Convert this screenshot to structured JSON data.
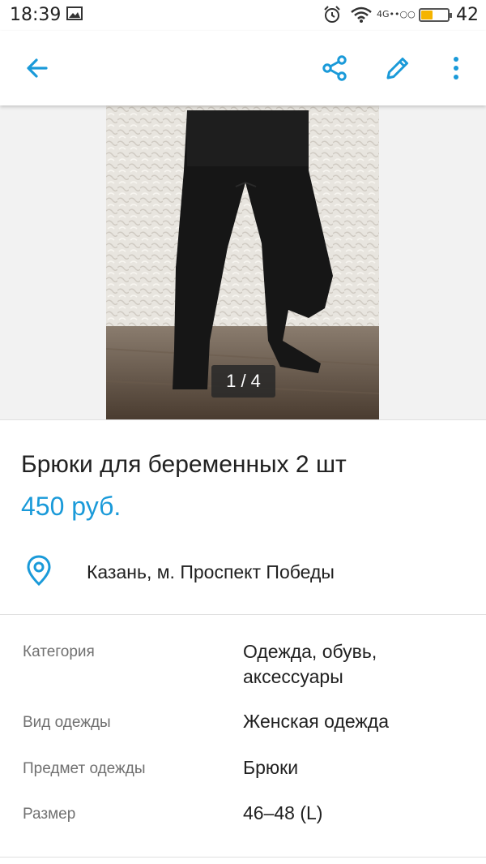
{
  "status_bar": {
    "time": "18:39",
    "network": "4G••○○",
    "battery_level": "42",
    "battery_fraction": 0.42,
    "icons": [
      "image-icon",
      "alarm-icon",
      "wifi-icon",
      "battery-icon"
    ]
  },
  "toolbar": {
    "icons": [
      "back-arrow-icon",
      "share-icon",
      "edit-pencil-icon",
      "more-vert-icon"
    ],
    "accent_color": "#1a9ad9"
  },
  "gallery": {
    "counter": "1 / 4"
  },
  "listing": {
    "title": "Брюки для беременных 2 шт",
    "price": "450 руб.",
    "price_color": "#1a9ad9",
    "location": "Казань, м. Проспект Победы"
  },
  "params": [
    {
      "label": "Категория",
      "value": "Одежда, обувь, аксессуары"
    },
    {
      "label": "Вид одежды",
      "value": "Женская одежда"
    },
    {
      "label": "Предмет одежды",
      "value": "Брюки"
    },
    {
      "label": "Размер",
      "value": "46–48 (L)"
    }
  ]
}
